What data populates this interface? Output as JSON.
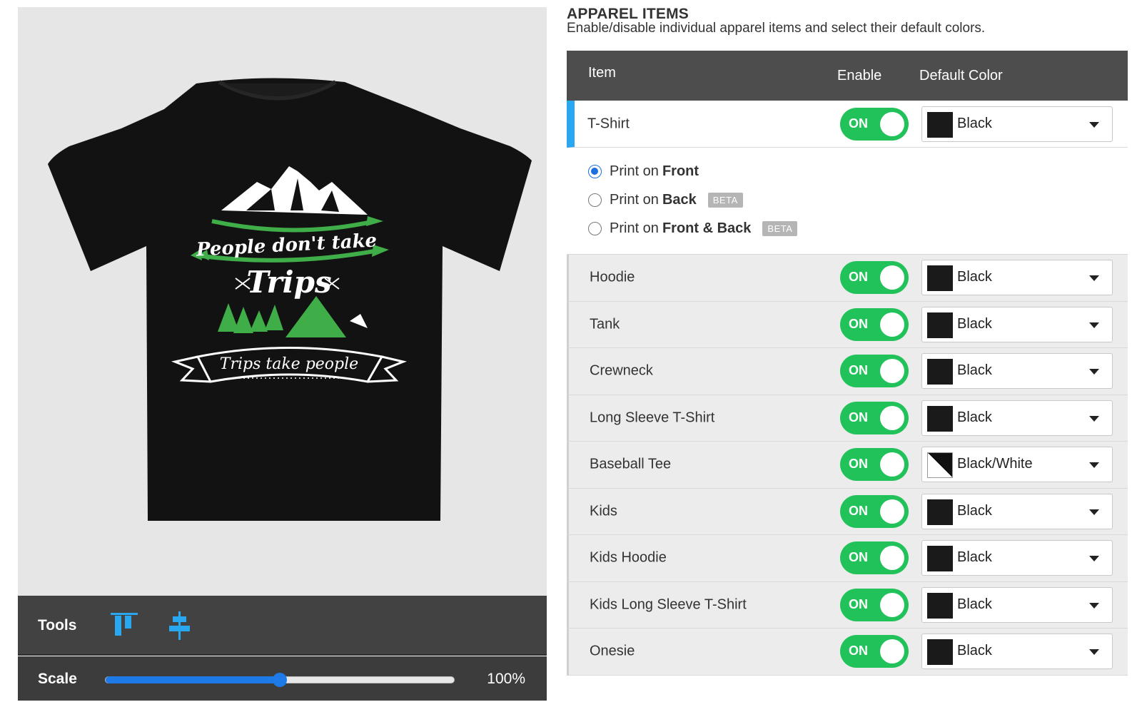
{
  "tools": {
    "label": "Tools"
  },
  "scale": {
    "label": "Scale",
    "value": "100%",
    "slider_fraction": 0.5
  },
  "design": {
    "line1": "People don't take",
    "line2": "Trips",
    "line3": "Trips take people"
  },
  "section": {
    "title": "APPAREL ITEMS",
    "subtitle": "Enable/disable individual apparel items and select their default colors."
  },
  "table": {
    "headers": {
      "item": "Item",
      "enable": "Enable",
      "color": "Default Color"
    },
    "toggle_label": "ON",
    "print_options": [
      {
        "prefix": "Print on",
        "bold": "Front",
        "badge": "",
        "checked": true
      },
      {
        "prefix": "Print on",
        "bold": "Back",
        "badge": "BETA",
        "checked": false
      },
      {
        "prefix": "Print on",
        "bold": "Front & Back",
        "badge": "BETA",
        "checked": false
      }
    ],
    "rows": [
      {
        "name": "T-Shirt",
        "color": "Black"
      },
      {
        "name": "Hoodie",
        "color": "Black"
      },
      {
        "name": "Tank",
        "color": "Black"
      },
      {
        "name": "Crewneck",
        "color": "Black"
      },
      {
        "name": "Long Sleeve T-Shirt",
        "color": "Black"
      },
      {
        "name": "Baseball Tee",
        "color": "Black/White"
      },
      {
        "name": "Kids",
        "color": "Black"
      },
      {
        "name": "Kids Hoodie",
        "color": "Black"
      },
      {
        "name": "Kids Long Sleeve T-Shirt",
        "color": "Black"
      },
      {
        "name": "Onesie",
        "color": "Black"
      }
    ]
  },
  "colors": {
    "accent": "#29a8f1",
    "toggle_on": "#21c259",
    "header_bg": "#4d4d4d",
    "design_green": "#3fae49"
  }
}
